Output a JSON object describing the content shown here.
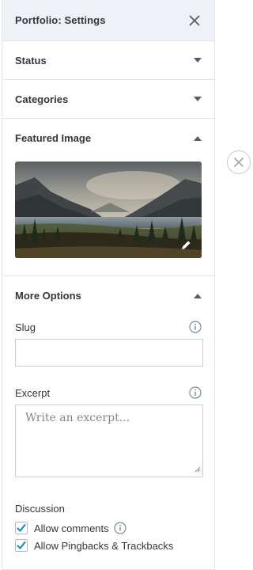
{
  "header": {
    "title": "Portfolio: Settings"
  },
  "sections": {
    "status": {
      "label": "Status"
    },
    "categories": {
      "label": "Categories"
    },
    "featured_image": {
      "label": "Featured Image"
    },
    "more_options": {
      "label": "More Options"
    }
  },
  "slug": {
    "label": "Slug",
    "value": ""
  },
  "excerpt": {
    "label": "Excerpt",
    "placeholder": "Write an excerpt..."
  },
  "discussion": {
    "label": "Discussion",
    "allow_comments": {
      "label": "Allow comments",
      "checked": true
    },
    "allow_pingbacks": {
      "label": "Allow Pingbacks & Trackbacks",
      "checked": true
    }
  },
  "colors": {
    "accent": "#0085ba",
    "header_bg": "#eef2f7",
    "muted": "#7e8993"
  },
  "icons": {
    "close": "close-icon",
    "caret_down": "caret-down-icon",
    "caret_up": "caret-up-icon",
    "info": "info-icon",
    "edit": "pencil-icon",
    "remove": "remove-icon"
  }
}
